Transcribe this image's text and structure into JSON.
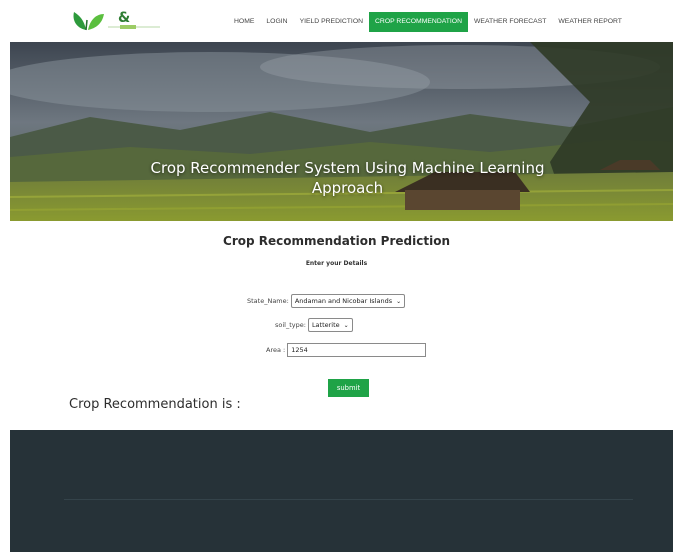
{
  "nav": {
    "items": [
      {
        "label": "HOME",
        "active": false
      },
      {
        "label": "LOGIN",
        "active": false
      },
      {
        "label": "YIELD PREDICTION",
        "active": false
      },
      {
        "label": "CROP RECOMMENDATION",
        "active": true
      },
      {
        "label": "WEATHER FORECAST",
        "active": false
      },
      {
        "label": "WEATHER REPORT",
        "active": false
      }
    ]
  },
  "hero": {
    "title_line1": "Crop Recommender System Using Machine Learning",
    "title_line2": "Approach"
  },
  "main": {
    "title": "Crop Recommendation Prediction",
    "subtitle": "Enter your Details"
  },
  "form": {
    "state_label": "State_Name:",
    "state_value": "Andaman and Nicobar Islands",
    "soil_label": "soil_type:",
    "soil_value": "Latterite",
    "area_label": "Area :",
    "area_value": "1254",
    "submit_label": "submit"
  },
  "result": {
    "label": "Crop Recommendation is :"
  },
  "colors": {
    "accent": "#1fa347",
    "footer": "#263238"
  },
  "icons": [
    "leaf-logo-icon",
    "chevron-down-icon"
  ]
}
